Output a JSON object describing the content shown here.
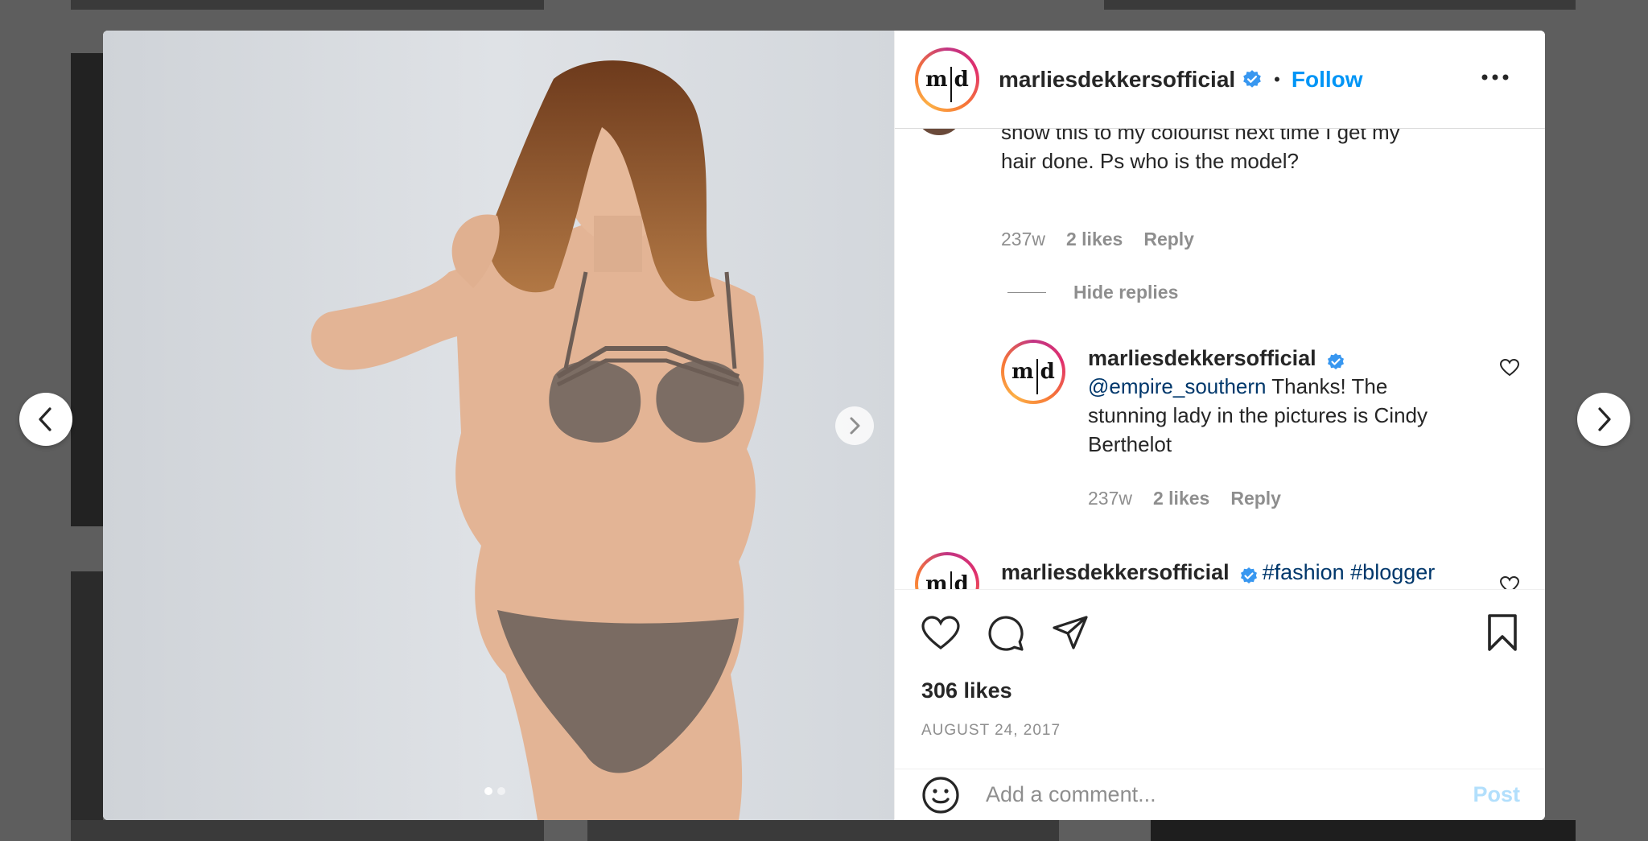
{
  "post": {
    "username": "marliesdekkersofficial",
    "avatar_text_left": "m",
    "avatar_text_right": "d",
    "follow_label": "Follow",
    "separator": "•"
  },
  "comments": {
    "first": {
      "text_line1": "show this to my colourist next time I get my",
      "text_line2": "hair done. Ps who is the model?",
      "time": "237w",
      "likes": "2 likes",
      "reply_label": "Reply"
    },
    "hide_replies_label": "Hide replies",
    "reply": {
      "username": "marliesdekkersofficial",
      "mention": "@empire_southern",
      "text_line1": "Thanks! The",
      "text_line2": "stunning lady in the pictures is Cindy",
      "text_line3": "Berthelot",
      "time": "237w",
      "likes": "2 likes",
      "reply_label": "Reply"
    },
    "caption": {
      "username": "marliesdekkersofficial",
      "hashtags": "#fashion #blogger"
    }
  },
  "footer": {
    "likes": "306 likes",
    "date": "AUGUST 24, 2017",
    "comment_placeholder": "Add a comment...",
    "post_label": "Post"
  },
  "carousel": {
    "total": 2,
    "active": 1
  },
  "icons": [
    "chevron-left-icon",
    "chevron-right-icon",
    "heart-icon",
    "comment-icon",
    "share-icon",
    "bookmark-icon",
    "more-icon",
    "emoji-icon",
    "verified-icon"
  ],
  "colors": {
    "accent": "#0095f6",
    "link": "#00376b",
    "muted": "#8e8e8e",
    "text": "#262626",
    "verified": "#3897f0"
  }
}
